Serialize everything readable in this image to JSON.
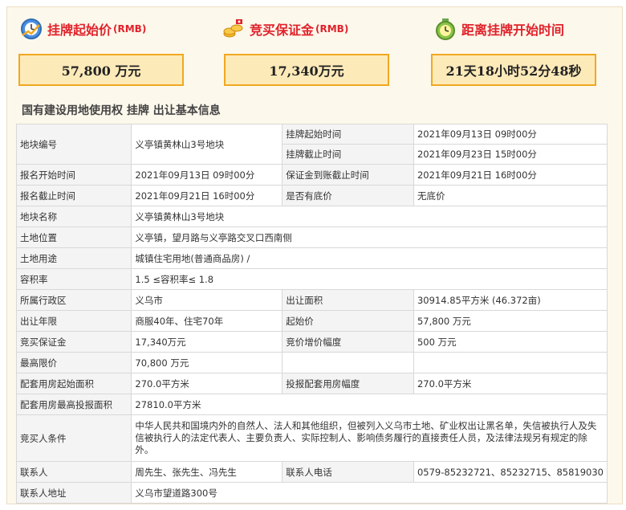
{
  "summary": {
    "start_price_label": "挂牌起始价",
    "start_price_unit": "(RMB)",
    "start_price_value": "57,800 万元",
    "deposit_label": "竞买保证金",
    "deposit_unit": "(RMB)",
    "deposit_value": "17,340万元",
    "countdown_label": "距离挂牌开始时间",
    "countdown_value": "21天18小时52分48秒",
    "accent_color": "#e0222b",
    "box_border_color": "#f0a821",
    "box_fill_color": "#fdeab9",
    "icons": [
      "clock-icon",
      "coins-icon",
      "timer-icon"
    ]
  },
  "section_title": "国有建设用地使用权 挂牌 出让基本信息",
  "table": {
    "lot_no_label": "地块编号",
    "lot_no": "义亭镇黄林山3号地块",
    "listing_start_label": "挂牌起始时间",
    "listing_start": "2021年09月13日 09时00分",
    "listing_end_label": "挂牌截止时间",
    "listing_end": "2021年09月23日 15时00分",
    "reg_start_label": "报名开始时间",
    "reg_start": "2021年09月13日 09时00分",
    "deposit_deadline_label": "保证金到账截止时间",
    "deposit_deadline": "2021年09月21日 16时00分",
    "reg_end_label": "报名截止时间",
    "reg_end": "2021年09月21日 16时00分",
    "reserve_label": "是否有底价",
    "reserve": "无底价",
    "lot_name_label": "地块名称",
    "lot_name": "义亭镇黄林山3号地块",
    "location_label": "土地位置",
    "location": "义亭镇，望月路与义亭路交叉口西南侧",
    "use_label": "土地用途",
    "use": "城镇住宅用地(普通商品房) /",
    "far_label": "容积率",
    "far": "1.5 ≤容积率≤ 1.8",
    "district_label": "所属行政区",
    "district": "义乌市",
    "area_label": "出让面积",
    "area": "30914.85平方米 (46.372亩)",
    "term_label": "出让年限",
    "term": "商服40年、住宅70年",
    "start_price_label": "起始价",
    "start_price": "57,800 万元",
    "deposit_label": "竞买保证金",
    "deposit": "17,340万元",
    "increment_label": "竞价增价幅度",
    "increment": "500 万元",
    "max_price_label": "最高限价",
    "max_price": "70,800 万元",
    "housing_start_label": "配套用房起始面积",
    "housing_start": "270.0平方米",
    "housing_increment_label": "投报配套用房幅度",
    "housing_increment": "270.0平方米",
    "housing_max_label": "配套用房最高投报面积",
    "housing_max": "27810.0平方米",
    "bidder_cond_label": "竞买人条件",
    "bidder_cond": "中华人民共和国境内外的自然人、法人和其他组织，但被列入义乌市土地、矿业权出让黑名单，失信被执行人及失信被执行人的法定代表人、主要负责人、实际控制人、影响债务履行的直接责任人员，及法律法规另有规定的除外。",
    "contact_label": "联系人",
    "contact": "周先生、张先生、冯先生",
    "phone_label": "联系人电话",
    "phone": "0579-85232721、85232715、85819030",
    "address_label": "联系人地址",
    "address": "义乌市望道路300号"
  }
}
